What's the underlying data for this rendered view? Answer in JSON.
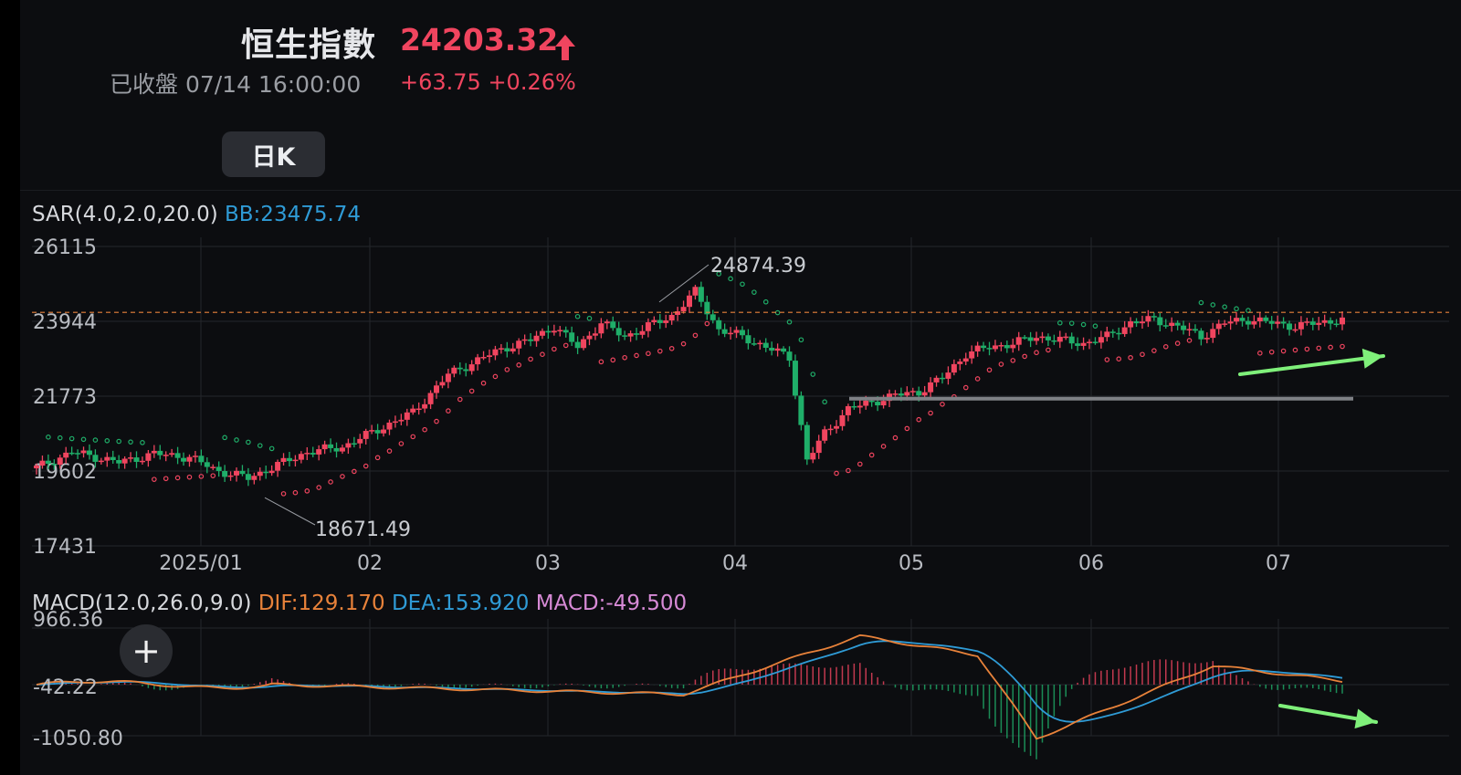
{
  "header": {
    "index_name": "恒生指數",
    "price": "24203.32",
    "status": "已收盤  07/14 16:00:00",
    "change": "+63.75 +0.26%"
  },
  "tabs": {
    "day_k": "日K"
  },
  "indicator": {
    "sar_label": "SAR(4.0,2.0,20.0)",
    "bb_label": "BB:23475.74"
  },
  "macd_header": {
    "title": "MACD(12.0,26.0,9.0)",
    "dif": "DIF:129.170",
    "dea": "DEA:153.920",
    "macd": "MACD:-49.500"
  },
  "colors": {
    "up": "#f0455f",
    "down": "#1fae69",
    "sar_up": "#f0455f",
    "sar_down": "#1fae69",
    "dif": "#e8823a",
    "dea": "#2f9bd6",
    "arrow": "#7ff07a",
    "last_price": "#e8823a"
  },
  "chart_data": [
    {
      "type": "candlestick",
      "title": "",
      "y_ticks": [
        26115,
        23944,
        21773,
        19602,
        17431
      ],
      "x_ticks": [
        "2025/01",
        "02",
        "03",
        "04",
        "05",
        "06",
        "07"
      ],
      "ylim": [
        17431,
        26115
      ],
      "last_price": 24203.32,
      "annotations": [
        {
          "label": "24874.39",
          "value": 24874.39
        },
        {
          "label": "18671.49",
          "value": 18671.49
        }
      ],
      "support_level": 21700,
      "grid": true,
      "series": [
        {
          "name": "SAR(4.0,2.0,20.0)",
          "kind": "parabolic-sar"
        }
      ]
    },
    {
      "type": "bar+line",
      "title": "MACD(12.0,26.0,9.0)",
      "y_ticks": [
        "966.36",
        "-42.22",
        "-1050.80"
      ],
      "ylim": [
        -1050.8,
        966.36
      ],
      "series": [
        {
          "name": "DIF",
          "last": 129.17
        },
        {
          "name": "DEA",
          "last": 153.92
        },
        {
          "name": "MACD",
          "last": -49.5
        }
      ],
      "grid": true
    }
  ]
}
